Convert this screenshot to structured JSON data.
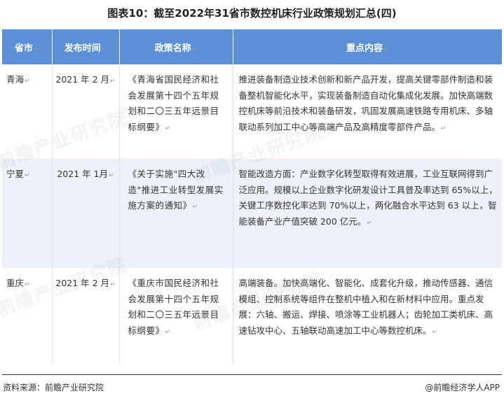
{
  "title": "图表10：截至2022年31省市数控机床行业政策规划汇总(四)",
  "table": {
    "headers": {
      "province": "省市",
      "date": "发布时间",
      "policy": "政策名称",
      "content": "重点内容"
    },
    "rows": [
      {
        "province": "青海",
        "date": "2021 年 2 月",
        "policy": "《青海省国民经济和社会发展第十四个五年规划和二〇三五年远景目标纲要》",
        "content": "推进装备制造业技术创新和新产品开发，提高关键零部件制造和装备整机智能化水平，实现装备制造自动化集成化发展。加快高端数控机床等前沿技术和装备研发，巩固发展高速铁路专用机床、多轴联动系列加工中心等高端产品及高精度零部件产品。"
      },
      {
        "province": "宁夏",
        "date": "2021 年 1月",
        "policy": "《关于实施\"四大改造\"推进工业转型发展实施方案的通知》",
        "content": "智能改造方面：产业数字化转型取得有效进展，工业互联网得到广泛应用。规模以上企业数字化研发设计工具普及率达到 65%以上，关键工序数控化率达到 70%以上，两化融合水平达到 63 以上，智能装备产业产值突破 200 亿元。"
      },
      {
        "province": "重庆",
        "date": "2021 年 2 月",
        "policy": "《重庆市国民经济和社会发展第十四个五年规划和二〇三五年远景目标纲要》",
        "content": "高端装备。加快高端化、智能化、成套化升级，推动传感器、通信模组、控制系统等组件在整机中植入和在新材料中应用。重点发展：六轴、搬运、焊接、喷涂等工业机器人；齿轮加工类机床、高速钻攻中心、五轴联动高速加工中心等数控机床。"
      }
    ],
    "return_mark": "↵"
  },
  "footer": {
    "source": "资料来源：前瞻产业研究院",
    "brand": "@前瞻经济学人APP"
  },
  "watermark": "前瞻产业研究院"
}
